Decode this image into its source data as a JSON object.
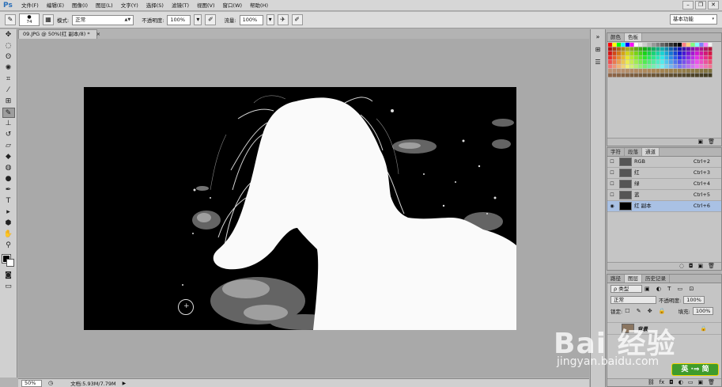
{
  "app": {
    "logo": "Ps",
    "menu": [
      "文件(F)",
      "编辑(E)",
      "图像(I)",
      "图层(L)",
      "文字(Y)",
      "选择(S)",
      "滤镜(T)",
      "视图(V)",
      "窗口(W)",
      "帮助(H)"
    ],
    "window_controls": [
      "–",
      "❐",
      "✕"
    ]
  },
  "options": {
    "brush_size": "74",
    "mode_label": "模式:",
    "mode_value": "正常",
    "opacity_label": "不透明度:",
    "opacity_value": "100%",
    "flow_label": "流量:",
    "flow_value": "100%",
    "workspace": "基本功能"
  },
  "document": {
    "tab_title": "09.JPG @ 50%(红 副本/8) *",
    "close": "×"
  },
  "status": {
    "zoom": "50%",
    "doc_info": "文档:5.93M/7.79M"
  },
  "swatches_panel": {
    "tabs": [
      "颜色",
      "色板"
    ],
    "active_tab": 1
  },
  "channels_panel": {
    "tabs": [
      "字符",
      "段落",
      "通道"
    ],
    "rows": [
      {
        "name": "RGB",
        "shortcut": "Ctrl+2"
      },
      {
        "name": "红",
        "shortcut": "Ctrl+3"
      },
      {
        "name": "绿",
        "shortcut": "Ctrl+4"
      },
      {
        "name": "蓝",
        "shortcut": "Ctrl+5"
      },
      {
        "name": "红 副本",
        "shortcut": "Ctrl+6"
      }
    ]
  },
  "layers_panel": {
    "tabs": [
      "路径",
      "图层",
      "历史记录"
    ],
    "filter_label": "ρ 类型",
    "blend_mode": "正常",
    "opacity_label": "不透明度:",
    "opacity_value": "100%",
    "lock_label": "锁定:",
    "fill_label": "填充:",
    "fill_value": "100%",
    "layer_name": "背景"
  },
  "watermark": {
    "brand": "Bai 经验",
    "url": "jingyan.baidu.com",
    "badge": "英 ·⇒ 简"
  },
  "colors": {
    "selection": "#a9c1e4",
    "canvas_bg": "#000000",
    "badge_green": "#3f9b2c"
  }
}
